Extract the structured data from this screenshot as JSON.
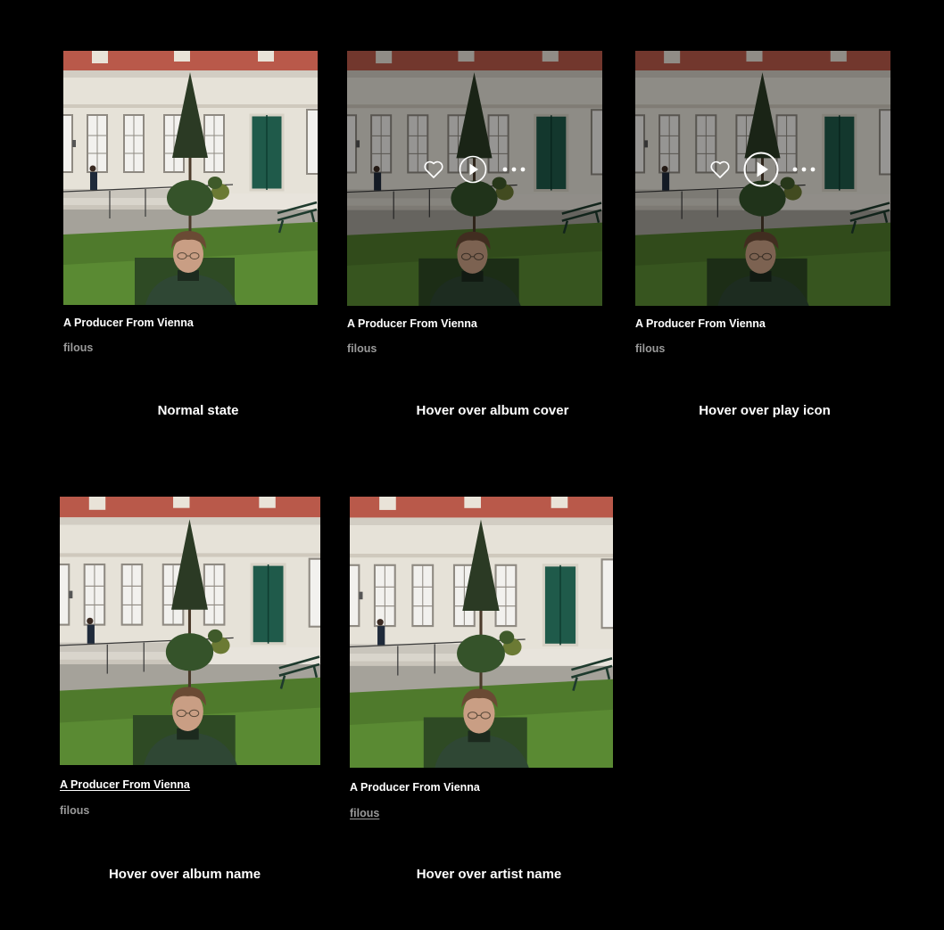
{
  "album_name": "A Producer From Vienna",
  "artist_name": "filous",
  "icons": {
    "heart": "heart-icon",
    "play": "play-icon",
    "more": "more-icon"
  },
  "states": [
    {
      "caption": "Normal state"
    },
    {
      "caption": "Hover over album cover"
    },
    {
      "caption": "Hover over play icon"
    },
    {
      "caption": "Hover over album name"
    },
    {
      "caption": "Hover over artist name"
    }
  ]
}
